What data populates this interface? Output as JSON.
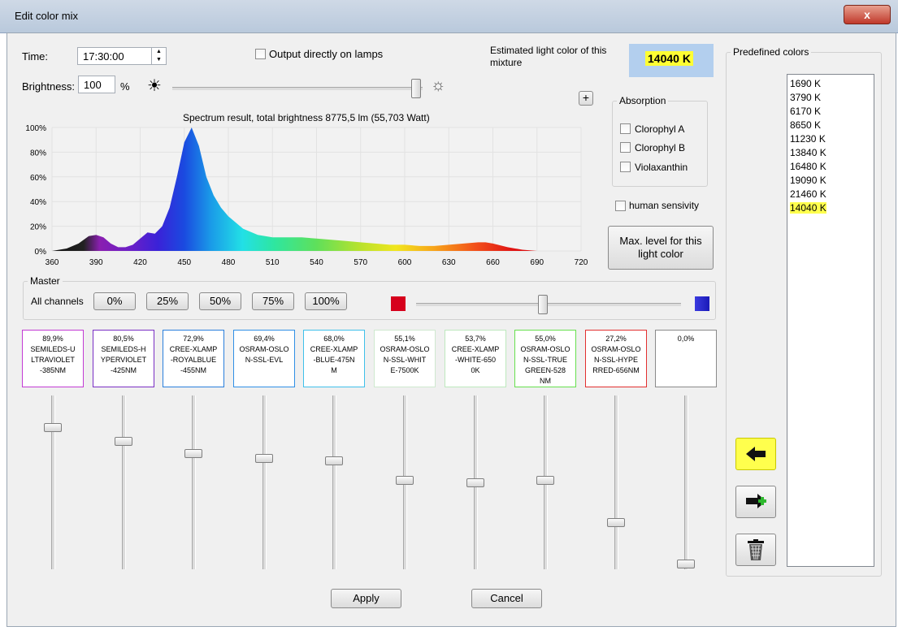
{
  "window": {
    "title": "Edit color mix",
    "close_label": "x"
  },
  "time": {
    "label": "Time:",
    "value": "17:30:00"
  },
  "brightness": {
    "label": "Brightness:",
    "value": "100",
    "unit": "%",
    "slider_level": 1.0
  },
  "output_lamps": {
    "label": "Output directly on lamps"
  },
  "estimated": {
    "label": "Estimated light color of this mixture",
    "value": "14040 K"
  },
  "absorption": {
    "title": "Absorption",
    "items": [
      "Clorophyl A",
      "Clorophyl B",
      "Violaxanthin"
    ]
  },
  "human_sensivity": {
    "label": "human sensivity"
  },
  "max_level_button": "Max. level for this light color",
  "plus_button": "+",
  "chart_data": {
    "type": "area",
    "title": "Spectrum result, total brightness 8775,5 lm (55,703 Watt)",
    "xlim": [
      360,
      720
    ],
    "ylim": [
      0,
      100
    ],
    "xticks": [
      "360",
      "390",
      "420",
      "450",
      "480",
      "510",
      "540",
      "570",
      "600",
      "630",
      "660",
      "690",
      "720"
    ],
    "yticks": [
      "0%",
      "20%",
      "40%",
      "60%",
      "80%",
      "100%"
    ],
    "x": [
      360,
      370,
      378,
      385,
      390,
      395,
      400,
      405,
      410,
      415,
      420,
      425,
      430,
      435,
      440,
      445,
      450,
      455,
      460,
      465,
      470,
      475,
      480,
      490,
      500,
      510,
      520,
      530,
      540,
      550,
      560,
      570,
      580,
      590,
      600,
      610,
      620,
      630,
      640,
      650,
      655,
      660,
      670,
      680,
      690,
      700,
      710,
      720
    ],
    "y": [
      0,
      2,
      6,
      12,
      13,
      11,
      6,
      3,
      3,
      5,
      10,
      15,
      14,
      20,
      35,
      60,
      88,
      100,
      85,
      60,
      45,
      35,
      28,
      18,
      13,
      11,
      11,
      11,
      10,
      9,
      8,
      7,
      6,
      5,
      5,
      4,
      4,
      5,
      6,
      7,
      7,
      6,
      3,
      1,
      0,
      0,
      0,
      0
    ]
  },
  "master": {
    "title": "Master",
    "all_channels_label": "All channels",
    "presets": [
      "0%",
      "25%",
      "50%",
      "75%",
      "100%"
    ],
    "slider_level": 0.48,
    "left_color": "#d6001c",
    "right_color": "#3b3bdf"
  },
  "channels": [
    {
      "pct": "89,9%",
      "name": [
        "SEMILEDS-U",
        "LTRAVIOLET",
        "-385NM"
      ],
      "color": "#c23bd4",
      "level": 0.899
    },
    {
      "pct": "80,5%",
      "name": [
        "SEMILEDS-H",
        "YPERVIOLET",
        "-425NM"
      ],
      "color": "#7a2fc4",
      "level": 0.805
    },
    {
      "pct": "72,9%",
      "name": [
        "CREE-XLAMP",
        "-ROYALBLUE",
        "-455NM"
      ],
      "color": "#2a7fdc",
      "level": 0.729
    },
    {
      "pct": "69,4%",
      "name": [
        "OSRAM-OSLO",
        "N-SSL-EVL"
      ],
      "color": "#2f8fe6",
      "level": 0.694
    },
    {
      "pct": "68,0%",
      "name": [
        "CREE-XLAMP",
        "-BLUE-475N",
        "M"
      ],
      "color": "#3fc0ea",
      "level": 0.68
    },
    {
      "pct": "55,1%",
      "name": [
        "OSRAM-OSLO",
        "N-SSL-WHIT",
        "E-7500K"
      ],
      "color": "#cfe8cf",
      "level": 0.551
    },
    {
      "pct": "53,7%",
      "name": [
        "CREE-XLAMP",
        "-WHITE-650",
        "0K"
      ],
      "color": "#bde8bd",
      "level": 0.537
    },
    {
      "pct": "55,0%",
      "name": [
        "OSRAM-OSLO",
        "N-SSL-TRUE",
        "GREEN-528",
        "NM"
      ],
      "color": "#67e04f",
      "level": 0.55
    },
    {
      "pct": "27,2%",
      "name": [
        "OSRAM-OSLO",
        "N-SSL-HYPE",
        "RRED-656NM"
      ],
      "color": "#e23030",
      "level": 0.272
    },
    {
      "pct": "0,0%",
      "name": [],
      "color": "#8a8a8a",
      "level": 0.0
    }
  ],
  "predefined": {
    "title": "Predefined colors",
    "items": [
      "1690 K",
      "3790 K",
      "6170 K",
      "8650 K",
      "11230 K",
      "13840 K",
      "16480 K",
      "19090 K",
      "21460 K",
      "14040 K"
    ],
    "selected": 9
  },
  "side_icons": [
    "arrow-left-icon",
    "arrow-right-add-icon",
    "trash-icon"
  ],
  "highlight_color": "#ffff33",
  "buttons": {
    "apply": "Apply",
    "cancel": "Cancel"
  }
}
